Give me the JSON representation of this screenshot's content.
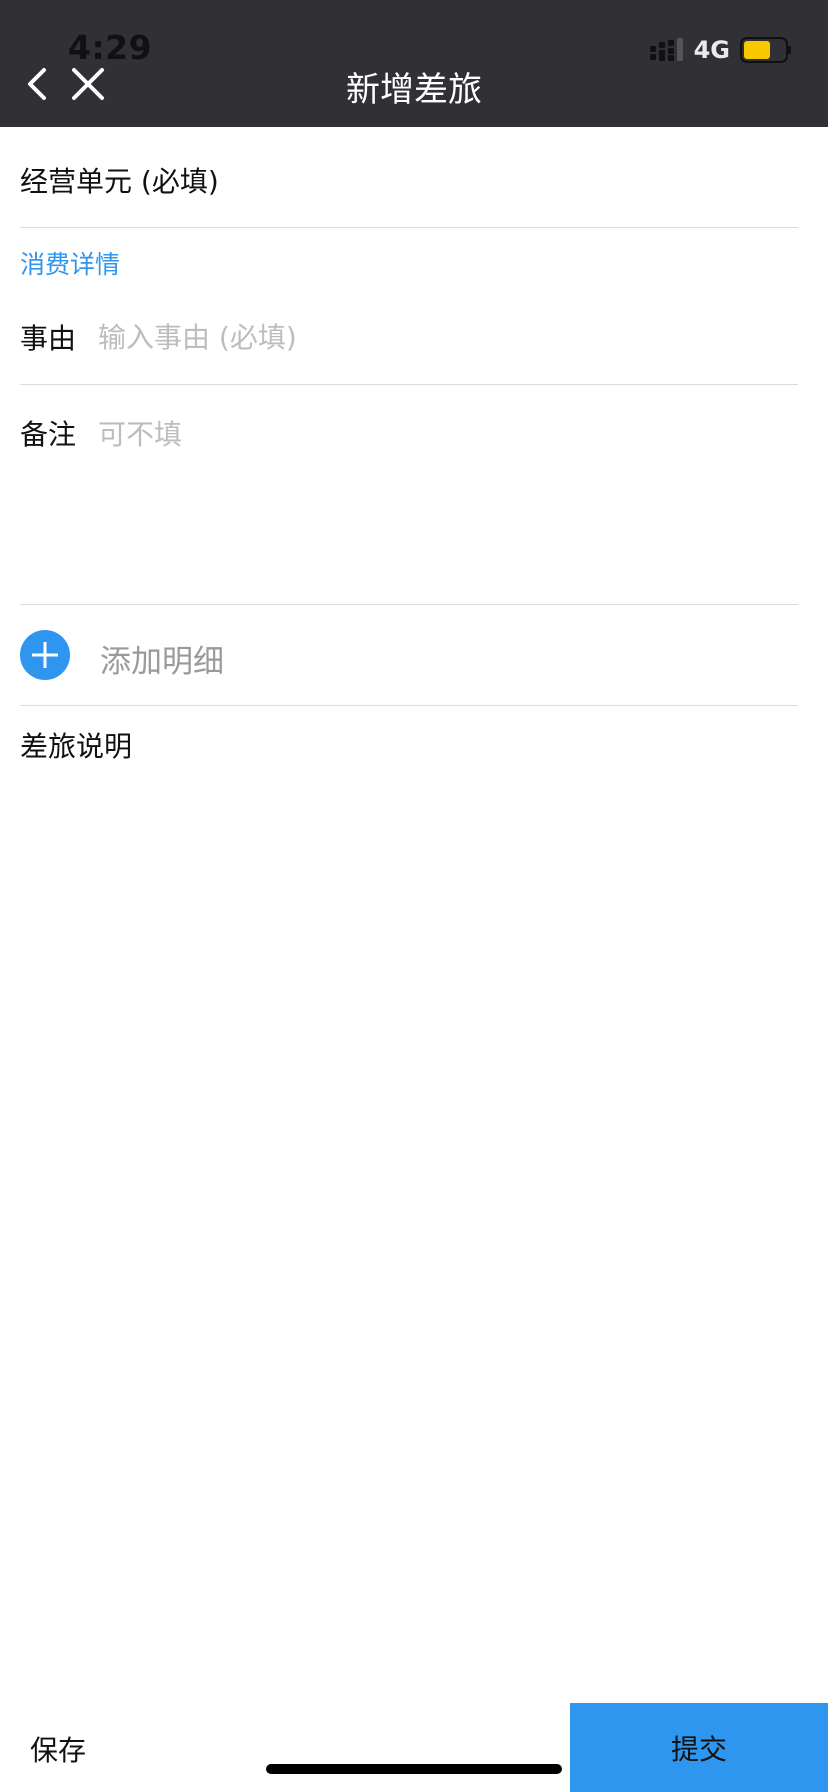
{
  "status_bar": {
    "time": "4:29",
    "network": "4G"
  },
  "nav": {
    "title": "新增差旅",
    "back_icon": "chevron-left-icon",
    "close_icon": "close-icon"
  },
  "form": {
    "business_unit_label": "经营单元 (必填)",
    "section_title": "消费详情",
    "reason": {
      "label": "事由",
      "placeholder": "输入事由 (必填)"
    },
    "remark": {
      "label": "备注",
      "placeholder": "可不填"
    },
    "add_detail_label": "添加明细",
    "travel_note_label": "差旅说明"
  },
  "actions": {
    "save_label": "保存",
    "submit_label": "提交"
  },
  "colors": {
    "header_bg": "#303035",
    "accent": "#2f96f0",
    "divider": "#dcdcdc",
    "placeholder": "#bdbdbd",
    "battery": "#f8c800"
  }
}
